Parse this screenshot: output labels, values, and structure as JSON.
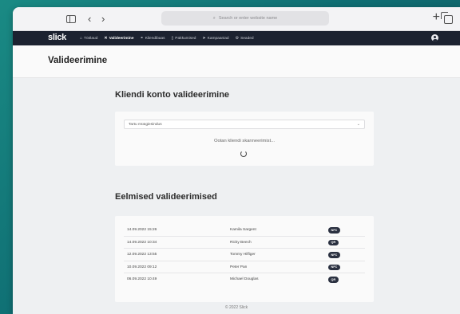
{
  "browser": {
    "url_placeholder": "Search or enter website name",
    "back_glyph": "‹",
    "forward_glyph": "›",
    "new_tab_glyph": "+"
  },
  "app": {
    "logo": "slick",
    "nav": [
      {
        "icon": "⌂",
        "label": "Töölaud",
        "active": false
      },
      {
        "icon": "✕",
        "label": "Valideerimine",
        "active": true
      },
      {
        "icon": "⚭",
        "label": "Kliendibaas",
        "active": false
      },
      {
        "icon": "▯",
        "label": "Pakkumised",
        "active": false
      },
      {
        "icon": "➤",
        "label": "Kampaaniad",
        "active": false
      },
      {
        "icon": "⚙",
        "label": "Seaded",
        "active": false
      }
    ]
  },
  "page": {
    "title": "Valideerimine"
  },
  "validation": {
    "heading": "Kliendi konto valideerimine",
    "store_select": "Tartu müügiesindus",
    "waiting_text": "Ootan kliendi skanneerimist..."
  },
  "history": {
    "heading": "Eelmised valideerimised",
    "rows": [
      {
        "date": "14.09.2022 15:26",
        "name": "Kamila Sargent",
        "badge": "NFC"
      },
      {
        "date": "14.09.2022 10:34",
        "name": "Ricky Beech",
        "badge": "QR"
      },
      {
        "date": "12.09.2022 13:55",
        "name": "Tommy Hilfiger",
        "badge": "NFC"
      },
      {
        "date": "10.09.2022 09:12",
        "name": "Peter Pan",
        "badge": "NFC"
      },
      {
        "date": "06.09.2022 10:49",
        "name": "Michael Douglas",
        "badge": "QR"
      }
    ]
  },
  "footer": {
    "text": "© 2022 Slick"
  }
}
